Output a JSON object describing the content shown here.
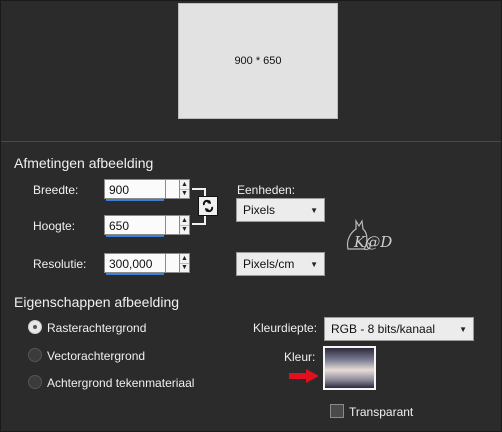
{
  "preview": {
    "text": "900 * 650"
  },
  "dimensions": {
    "title": "Afmetingen afbeelding",
    "width_label": "Breedte:",
    "width_value": "900",
    "height_label": "Hoogte:",
    "height_value": "650",
    "resolution_label": "Resolutie:",
    "resolution_value": "300,000",
    "units_label": "Eenheden:",
    "units_value": "Pixels",
    "resolution_units_value": "Pixels/cm"
  },
  "properties": {
    "title": "Eigenschappen afbeelding",
    "radio_options": [
      {
        "label": "Rasterachtergrond",
        "selected": true
      },
      {
        "label": "Vectorachtergrond",
        "selected": false
      },
      {
        "label": "Achtergrond tekenmateriaal",
        "selected": false
      }
    ],
    "color_depth_label": "Kleurdiepte:",
    "color_depth_value": "RGB - 8 bits/kanaal",
    "color_label": "Kleur:",
    "transparent_label": "Transparant",
    "transparent_checked": false
  },
  "watermark": {
    "text": "K@D"
  },
  "colors": {
    "background": "#2b2b2b",
    "accent_underline": "#3b82d6",
    "arrow": "#e0101f"
  }
}
